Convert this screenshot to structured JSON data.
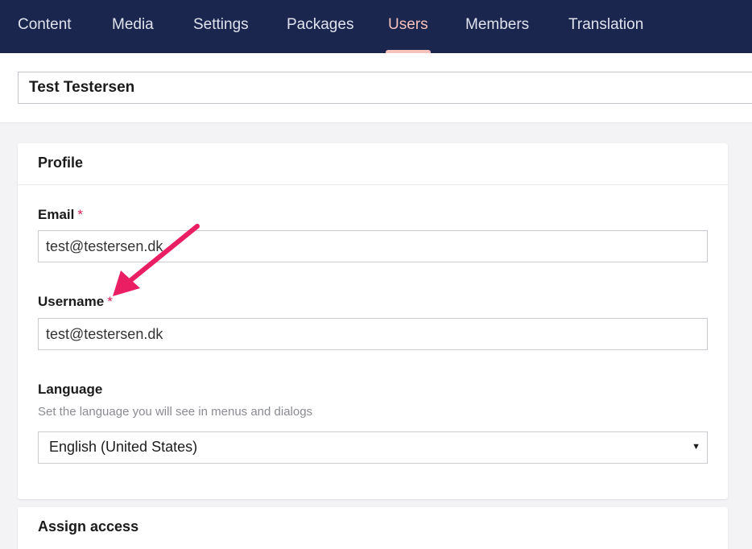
{
  "nav": {
    "items": [
      {
        "label": "Content"
      },
      {
        "label": "Media"
      },
      {
        "label": "Settings"
      },
      {
        "label": "Packages"
      },
      {
        "label": "Users"
      },
      {
        "label": "Members"
      },
      {
        "label": "Translation"
      }
    ],
    "active": "Users"
  },
  "name_field": {
    "value": "Test Testersen"
  },
  "profile": {
    "title": "Profile",
    "email": {
      "label": "Email",
      "required_mark": "*",
      "value": "test@testersen.dk"
    },
    "username": {
      "label": "Username",
      "required_mark": "*",
      "value": "test@testersen.dk"
    },
    "language": {
      "label": "Language",
      "description": "Set the language you will see in menus and dialogs",
      "selected": "English (United States)"
    }
  },
  "assign_access": {
    "title": "Assign access"
  },
  "colors": {
    "nav_background": "#1b264f",
    "nav_active": "#f5c1bc",
    "required": "#d42054",
    "annotation_arrow": "#e91e63"
  },
  "icons": {
    "select_caret": "triangle-down"
  }
}
